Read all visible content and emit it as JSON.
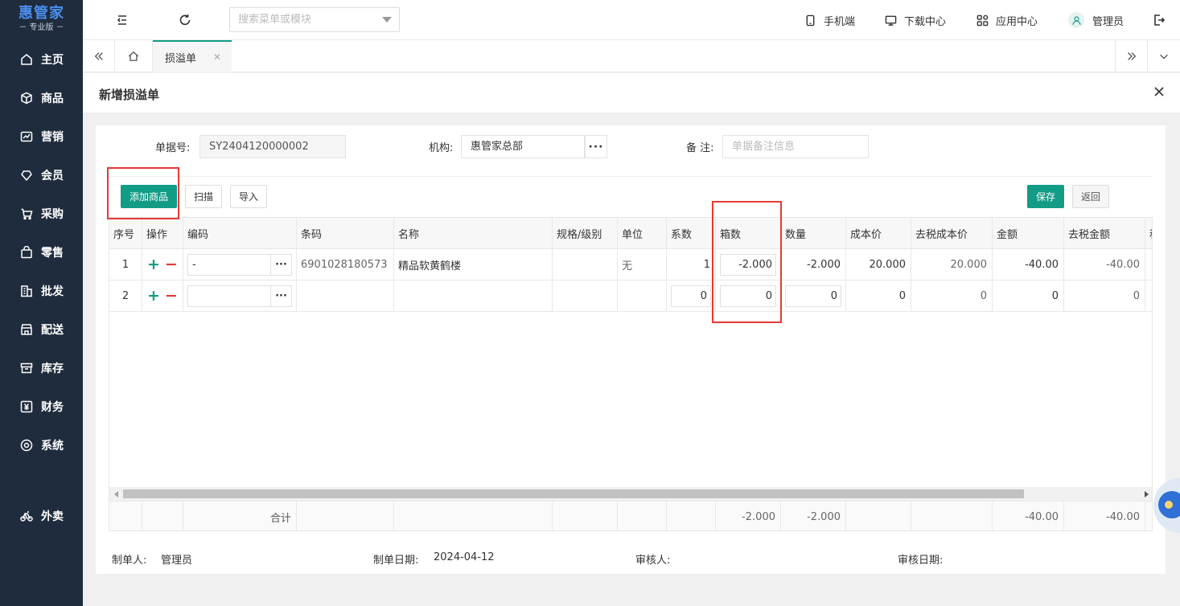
{
  "sidebar": {
    "logo_main": "惠管家",
    "logo_sub": "－ 专业版 －",
    "items": [
      {
        "label": "主页",
        "icon": "home-icon"
      },
      {
        "label": "商品",
        "icon": "cube-icon"
      },
      {
        "label": "营销",
        "icon": "chart-icon"
      },
      {
        "label": "会员",
        "icon": "diamond-icon"
      },
      {
        "label": "采购",
        "icon": "cart-icon"
      },
      {
        "label": "零售",
        "icon": "bag-icon"
      },
      {
        "label": "批发",
        "icon": "building-icon"
      },
      {
        "label": "配送",
        "icon": "store-icon"
      },
      {
        "label": "库存",
        "icon": "box-icon"
      },
      {
        "label": "财务",
        "icon": "yen-icon"
      },
      {
        "label": "系统",
        "icon": "settings-icon"
      },
      {
        "label": "外卖",
        "icon": "bike-icon"
      }
    ]
  },
  "topbar": {
    "search_placeholder": "搜索菜单或模块",
    "mobile": "手机端",
    "download": "下载中心",
    "apps": "应用中心",
    "user": "管理员"
  },
  "tabs": {
    "active": "损溢单"
  },
  "page": {
    "title": "新增损溢单"
  },
  "form": {
    "doc_no_label": "单据号:",
    "doc_no": "SY2404120000002",
    "org_label": "机构:",
    "org": "惠管家总部",
    "remark_label": "备 注:",
    "remark_placeholder": "单据备注信息"
  },
  "toolbar": {
    "add": "添加商品",
    "scan": "扫描",
    "import": "导入",
    "save": "保存",
    "back": "返回"
  },
  "table": {
    "headers": [
      "序号",
      "操作",
      "编码",
      "条码",
      "名称",
      "规格/级别",
      "单位",
      "系数",
      "箱数",
      "数量",
      "成本价",
      "去税成本价",
      "金额",
      "去税金额",
      "税"
    ],
    "rows": [
      {
        "no": "1",
        "code": "-",
        "barcode": "6901028180573",
        "name": "精品软黄鹤楼",
        "spec": "",
        "unit": "无",
        "factor": "1",
        "boxes": "-2.000",
        "qty": "-2.000",
        "cost": "20.000",
        "cost_ex": "20.000",
        "amount": "-40.00",
        "amount_ex": "-40.00"
      },
      {
        "no": "2",
        "code": "",
        "barcode": "",
        "name": "",
        "spec": "",
        "unit": "",
        "factor": "0",
        "boxes": "0",
        "qty": "0",
        "cost": "0",
        "cost_ex": "0",
        "amount": "0",
        "amount_ex": "0"
      }
    ],
    "total_label": "合计",
    "totals": {
      "boxes": "-2.000",
      "qty": "-2.000",
      "amount": "-40.00",
      "amount_ex": "-40.00"
    }
  },
  "footer": {
    "creator_label": "制单人:",
    "creator": "管理员",
    "date_label": "制单日期:",
    "date": "2024-04-12",
    "auditor_label": "审核人:",
    "auditor": "",
    "audit_date_label": "审核日期:",
    "audit_date": ""
  }
}
